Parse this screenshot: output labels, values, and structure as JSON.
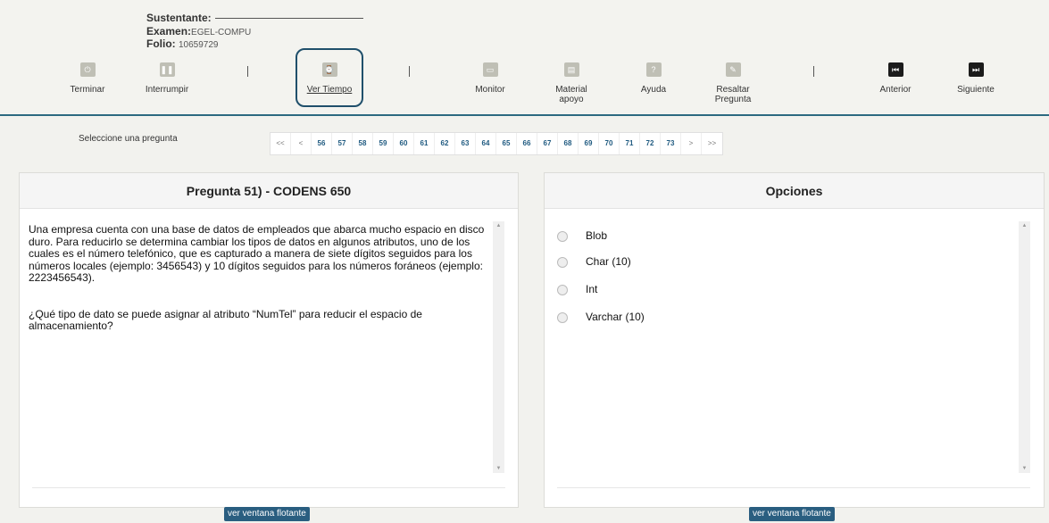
{
  "info": {
    "sustentante_label": "Sustentante:",
    "examen_label": "Examen:",
    "examen_value": "EGEL-COMPU",
    "folio_label": "Folio:",
    "folio_value": "10659729"
  },
  "toolbar": {
    "terminar": "Terminar",
    "interrumpir": "Interrumpir",
    "ver_tiempo": "Ver Tiempo",
    "monitor": "Monitor",
    "material_apoyo": "Material apoyo",
    "ayuda": "Ayuda",
    "resaltar_pregunta": "Resaltar Pregunta",
    "anterior": "Anterior",
    "siguiente": "Siguiente"
  },
  "nav": {
    "label": "Seleccione una pregunta",
    "first": "<<",
    "prev": "<",
    "pages": [
      "56",
      "57",
      "58",
      "59",
      "60",
      "61",
      "62",
      "63",
      "64",
      "65",
      "66",
      "67",
      "68",
      "69",
      "70",
      "71",
      "72",
      "73"
    ],
    "next": ">",
    "last": ">>"
  },
  "question": {
    "title": "Pregunta 51) - CODENS 650",
    "paragraph1": "Una empresa cuenta con una base de datos de empleados que abarca mucho espacio en disco duro. Para reducirlo se determina cambiar los tipos de datos en algunos atributos, uno de los cuales es el número telefónico, que es capturado a manera de siete dígitos seguidos para los números locales (ejemplo: 3456543) y 10 dígitos seguidos para los números foráneos (ejemplo: 2223456543).",
    "paragraph2": "¿Qué tipo de dato se puede asignar al atributo “NumTel” para reducir el espacio de almacenamiento?",
    "float_button": "ver ventana flotante"
  },
  "options": {
    "title": "Opciones",
    "items": [
      "Blob",
      "Char (10)",
      "Int",
      "Varchar (10)"
    ],
    "float_button": "ver ventana flotante"
  }
}
